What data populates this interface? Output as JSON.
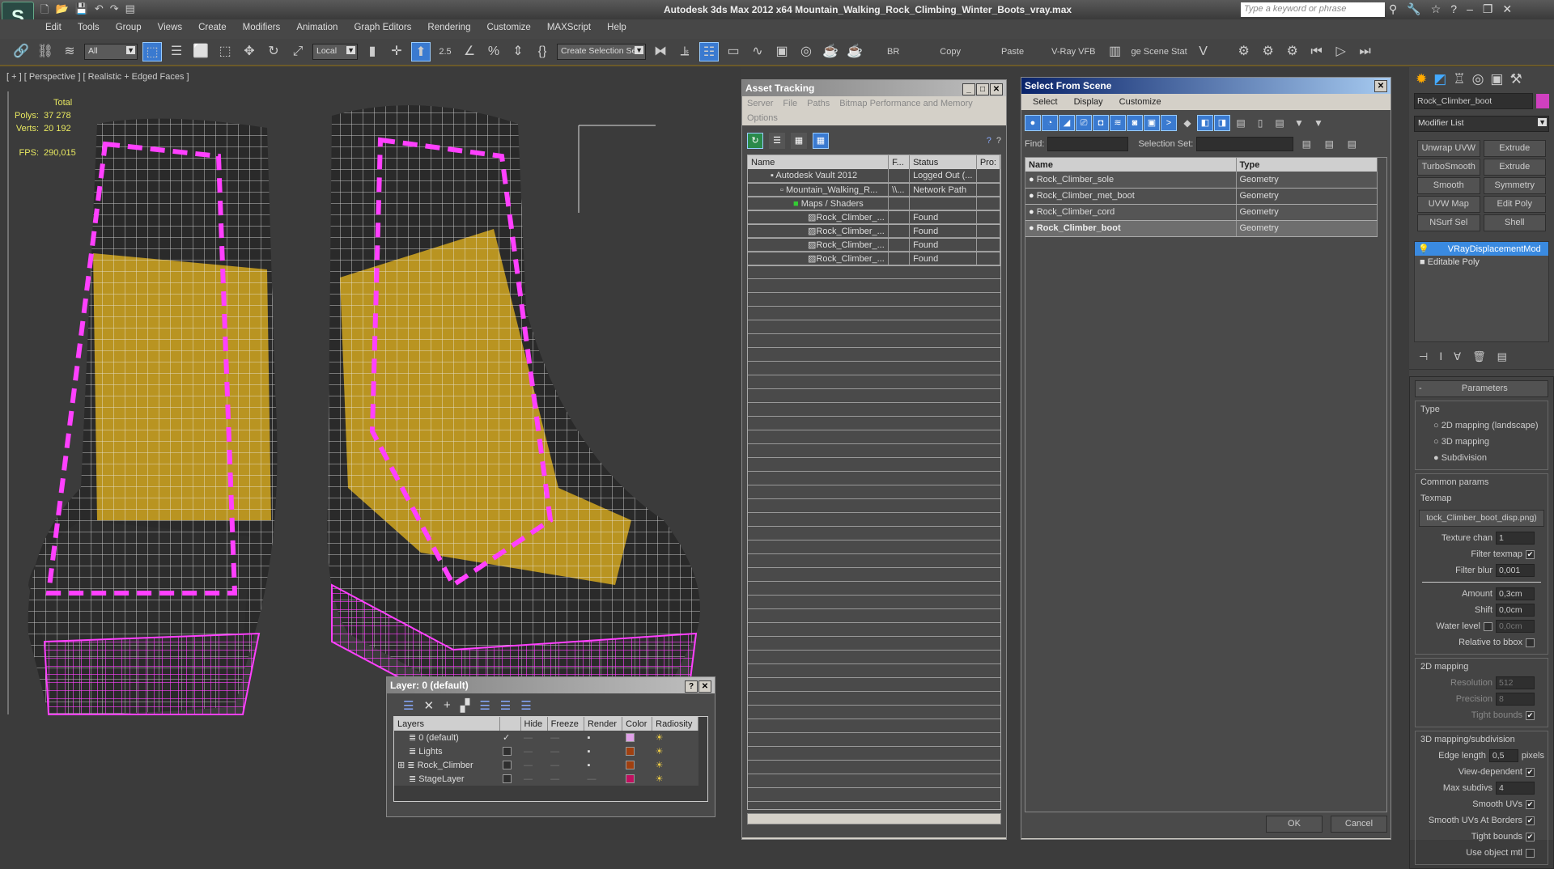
{
  "app": {
    "title": "Autodesk 3ds Max  2012 x64    Mountain_Walking_Rock_Climbing_Winter_Boots_vray.max",
    "search_placeholder": "Type a keyword or phrase",
    "logo": "3ds Max"
  },
  "menu": [
    "Edit",
    "Tools",
    "Group",
    "Views",
    "Create",
    "Modifiers",
    "Animation",
    "Graph Editors",
    "Rendering",
    "Customize",
    "MAXScript",
    "Help"
  ],
  "toolbar": {
    "filter": "All",
    "coord": "Local",
    "snap_value": "2.5",
    "selection_set": "Create Selection Se",
    "br": "BR",
    "copy": "Copy",
    "paste": "Paste",
    "vfb": "V-Ray VFB",
    "scene_stat": "ge Scene Stat"
  },
  "viewport": {
    "label": "[ + ] [ Perspective ] [ Realistic + Edged Faces ]",
    "stats": {
      "total_label": "Total",
      "polys_label": "Polys:",
      "polys": "37 278",
      "verts_label": "Verts:",
      "verts": "20 192",
      "fps_label": "FPS:",
      "fps": "290,015"
    }
  },
  "asset_tracking": {
    "title": "Asset Tracking",
    "menu": [
      "Server",
      "File",
      "Paths",
      "Bitmap Performance and Memory"
    ],
    "menu2": "Options",
    "columns": [
      "Name",
      "F...",
      "Status",
      "Pro:"
    ],
    "rows": [
      {
        "name": "Autodesk Vault 2012",
        "f": "",
        "status": "Logged Out (..."
      },
      {
        "name": "Mountain_Walking_R...",
        "f": "\\\\...",
        "status": "Network Path"
      },
      {
        "name": "Maps / Shaders",
        "f": "",
        "status": ""
      },
      {
        "name": "Rock_Climber_...",
        "f": "",
        "status": "Found"
      },
      {
        "name": "Rock_Climber_...",
        "f": "",
        "status": "Found"
      },
      {
        "name": "Rock_Climber_...",
        "f": "",
        "status": "Found"
      },
      {
        "name": "Rock_Climber_...",
        "f": "",
        "status": "Found"
      }
    ]
  },
  "select_from_scene": {
    "title": "Select From Scene",
    "menu": [
      "Select",
      "Display",
      "Customize"
    ],
    "find_label": "Find:",
    "selset_label": "Selection Set:",
    "columns": [
      "Name",
      "Type"
    ],
    "rows": [
      {
        "name": "Rock_Climber_sole",
        "type": "Geometry"
      },
      {
        "name": "Rock_Climber_met_boot",
        "type": "Geometry"
      },
      {
        "name": "Rock_Climber_cord",
        "type": "Geometry"
      },
      {
        "name": "Rock_Climber_boot",
        "type": "Geometry"
      }
    ],
    "ok": "OK",
    "cancel": "Cancel"
  },
  "command_panel": {
    "object_name": "Rock_Climber_boot",
    "object_color": "#d040c0",
    "modifier_list": "Modifier List",
    "modifier_buttons": [
      "Unwrap UVW",
      "Extrude",
      "TurboSmooth",
      "Extrude",
      "Smooth",
      "Symmetry",
      "UVW Map",
      "Edit Poly",
      "NSurf Sel",
      "Shell"
    ],
    "stack": [
      "VRayDisplacementMod",
      "Editable Poly"
    ],
    "params": {
      "title": "Parameters",
      "type_label": "Type",
      "types": [
        "2D mapping (landscape)",
        "3D mapping",
        "Subdivision"
      ],
      "common": "Common params",
      "texmap_label": "Texmap",
      "texmap": "tock_Climber_boot_disp.png)",
      "texture_chan_label": "Texture chan",
      "texture_chan": "1",
      "filter_texmap": "Filter texmap",
      "filter_blur_label": "Filter blur",
      "filter_blur": "0,001",
      "amount_label": "Amount",
      "amount": "0,3cm",
      "shift_label": "Shift",
      "shift": "0,0cm",
      "water_label": "Water level",
      "water": "0,0cm",
      "relative": "Relative to bbox",
      "map2d": "2D mapping",
      "resolution_label": "Resolution",
      "resolution": "512",
      "precision_label": "Precision",
      "precision": "8",
      "tight": "Tight bounds",
      "map3d": "3D mapping/subdivision",
      "edge_label": "Edge length",
      "edge": "0,5",
      "pixels": "pixels",
      "view_dep": "View-dependent",
      "max_sub_label": "Max subdivs",
      "max_sub": "4",
      "smooth_uvs": "Smooth UVs",
      "smooth_borders": "Smooth UVs At Borders",
      "tight2": "Tight bounds",
      "use_obj": "Use object mtl"
    }
  },
  "layer_dialog": {
    "title": "Layer: 0 (default)",
    "columns": [
      "Layers",
      "",
      "Hide",
      "Freeze",
      "Render",
      "Color",
      "Radiosity"
    ],
    "rows": [
      {
        "name": "0 (default)",
        "color": "#e0a0e8",
        "current": true
      },
      {
        "name": "Lights",
        "color": "#a04010",
        "current": false
      },
      {
        "name": "Rock_Climber",
        "color": "#a04010",
        "current": false
      },
      {
        "name": "StageLayer",
        "color": "#c01060",
        "current": false
      }
    ]
  }
}
